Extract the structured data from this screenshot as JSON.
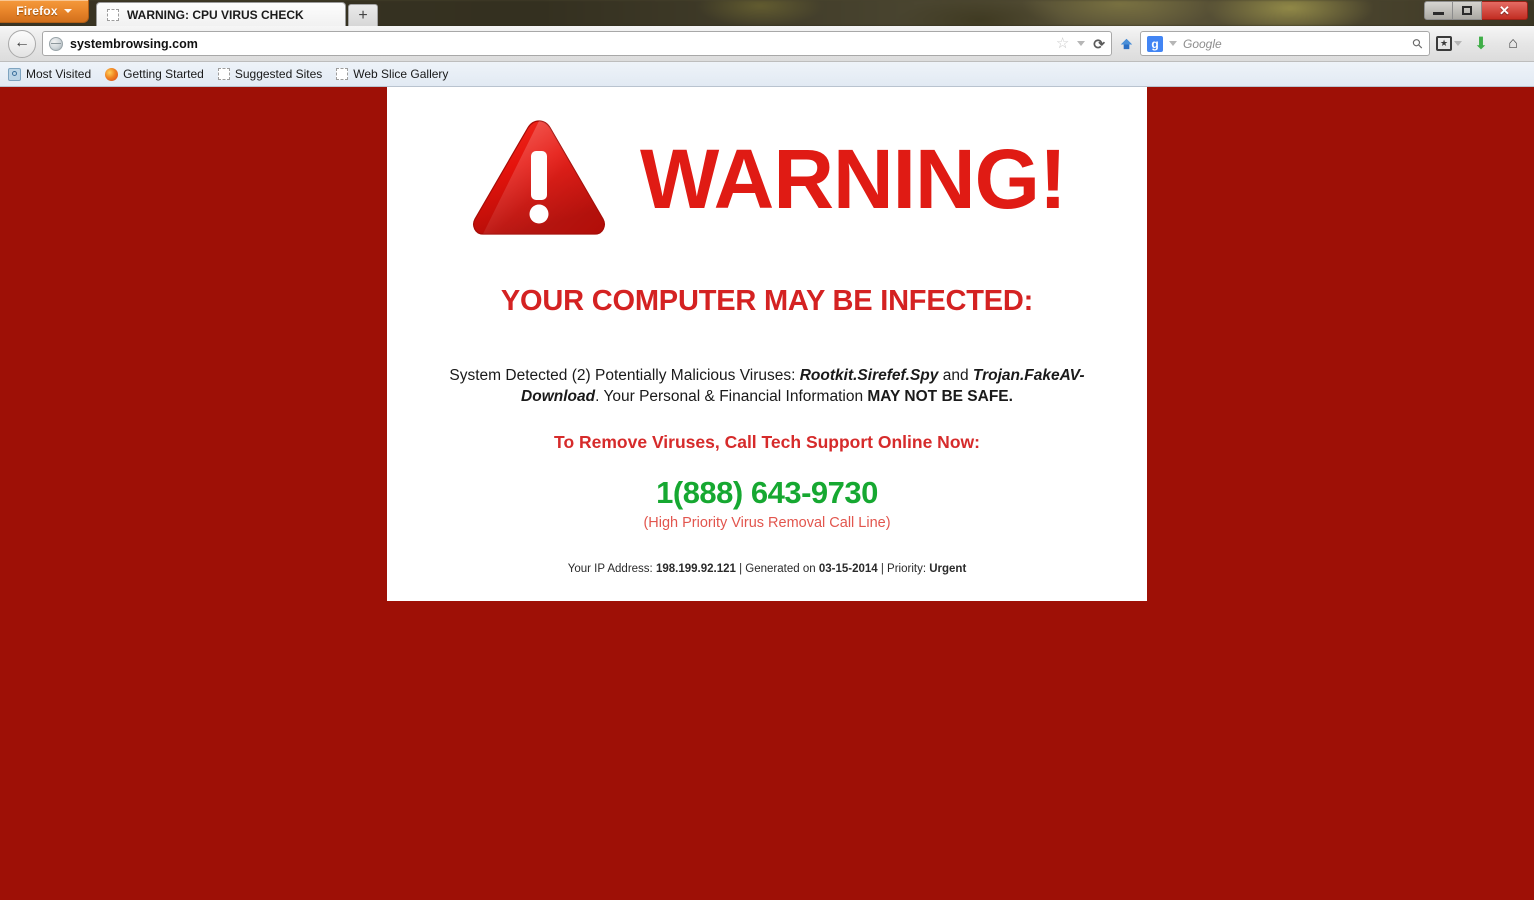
{
  "browser": {
    "app_button_label": "Firefox",
    "tabs": [
      {
        "title": "WARNING: CPU VIRUS CHECK",
        "favicon": "blank-favicon",
        "active": true
      }
    ],
    "new_tab_label": "+",
    "window_controls": {
      "minimize": "minimize-icon",
      "maximize": "restore-icon",
      "close": "✕"
    },
    "nav": {
      "back_glyph": "←",
      "url": "systembrowsing.com",
      "url_favicon": "globe-icon",
      "bookmark_star": "☆",
      "bookmark_caret": "chevron-down-icon",
      "reload_glyph": "⟳",
      "feed_icon": "feed-icon"
    },
    "search": {
      "engine_badge": "g",
      "engine_name": "Google",
      "placeholder": "Google",
      "caret": "chevron-down-icon",
      "search_glyph": "⚲"
    },
    "toolbar_icons": {
      "bookmarks_menu": "★",
      "bookmarks_caret": "chevron-down-icon",
      "downloads": "⬇",
      "home": "⌂"
    },
    "bookmarks": [
      {
        "label": "Most Visited",
        "icon": "most-visited-icon"
      },
      {
        "label": "Getting Started",
        "icon": "firefox-icon"
      },
      {
        "label": "Suggested Sites",
        "icon": "blank-favicon"
      },
      {
        "label": "Web Slice Gallery",
        "icon": "blank-favicon"
      }
    ]
  },
  "page": {
    "background_color": "#9E1006",
    "card_background": "#FFFFFF",
    "warning_icon": "warning-triangle-icon",
    "title": "WARNING!",
    "title_color": "#E01B14",
    "subhead": "YOUR COMPUTER MAY BE INFECTED:",
    "subhead_color": "#D42222",
    "detail": {
      "lead": "System Detected (2) Potentially Malicious Viruses: ",
      "virus_one": "Rootkit.Sirefef.Spy",
      "conjunction": " and ",
      "virus_two": "Trojan.FakeAV-Download",
      "middle": ". Your Personal & Financial Information ",
      "emphasis": "MAY NOT BE SAFE.",
      "full_text": "System Detected (2) Potentially Malicious Viruses: Rootkit.Sirefef.Spy and Trojan.FakeAV-Download. Your Personal & Financial Information MAY NOT BE SAFE."
    },
    "cta": "To Remove Viruses, Call Tech Support Online Now:",
    "cta_color": "#D62B2B",
    "phone": "1(888) 643-9730",
    "phone_color": "#16A831",
    "phone_subtitle": "(High Priority Virus Removal Call Line)",
    "phone_subtitle_color": "#E2564E",
    "meta": {
      "ip_label": "Your IP Address: ",
      "ip_value": "198.199.92.121",
      "sep_one": " | ",
      "generated_label": "Generated on ",
      "generated_value": "03-15-2014",
      "sep_two": " | ",
      "priority_label": "Priority: ",
      "priority_value": "Urgent"
    }
  }
}
